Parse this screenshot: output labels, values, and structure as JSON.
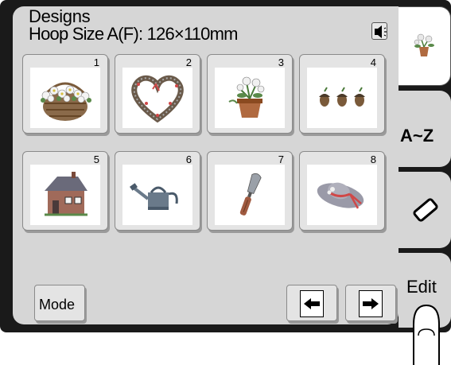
{
  "header": {
    "title": "Designs",
    "hoop_size": "Hoop Size A(F): 126×110mm",
    "speaker_icon": "speaker-icon"
  },
  "designs": [
    {
      "number": "1",
      "icon": "flower-basket-icon"
    },
    {
      "number": "2",
      "icon": "heart-wreath-icon"
    },
    {
      "number": "3",
      "icon": "flower-pot-icon"
    },
    {
      "number": "4",
      "icon": "acorns-icon"
    },
    {
      "number": "5",
      "icon": "house-icon"
    },
    {
      "number": "6",
      "icon": "watering-can-icon"
    },
    {
      "number": "7",
      "icon": "trowel-icon"
    },
    {
      "number": "8",
      "icon": "sun-hat-icon"
    }
  ],
  "buttons": {
    "mode": "Mode",
    "prev_icon": "page-prev-icon",
    "next_icon": "page-next-icon"
  },
  "tabs": {
    "az": "A~Z",
    "edit": "Edit",
    "eraser_icon": "eraser-icon",
    "preview_icon": "flower-pot-icon"
  },
  "colors": {
    "screen": "#d6d6d6",
    "bezel": "#1a1a1a",
    "tile": "#e4e4e4"
  }
}
